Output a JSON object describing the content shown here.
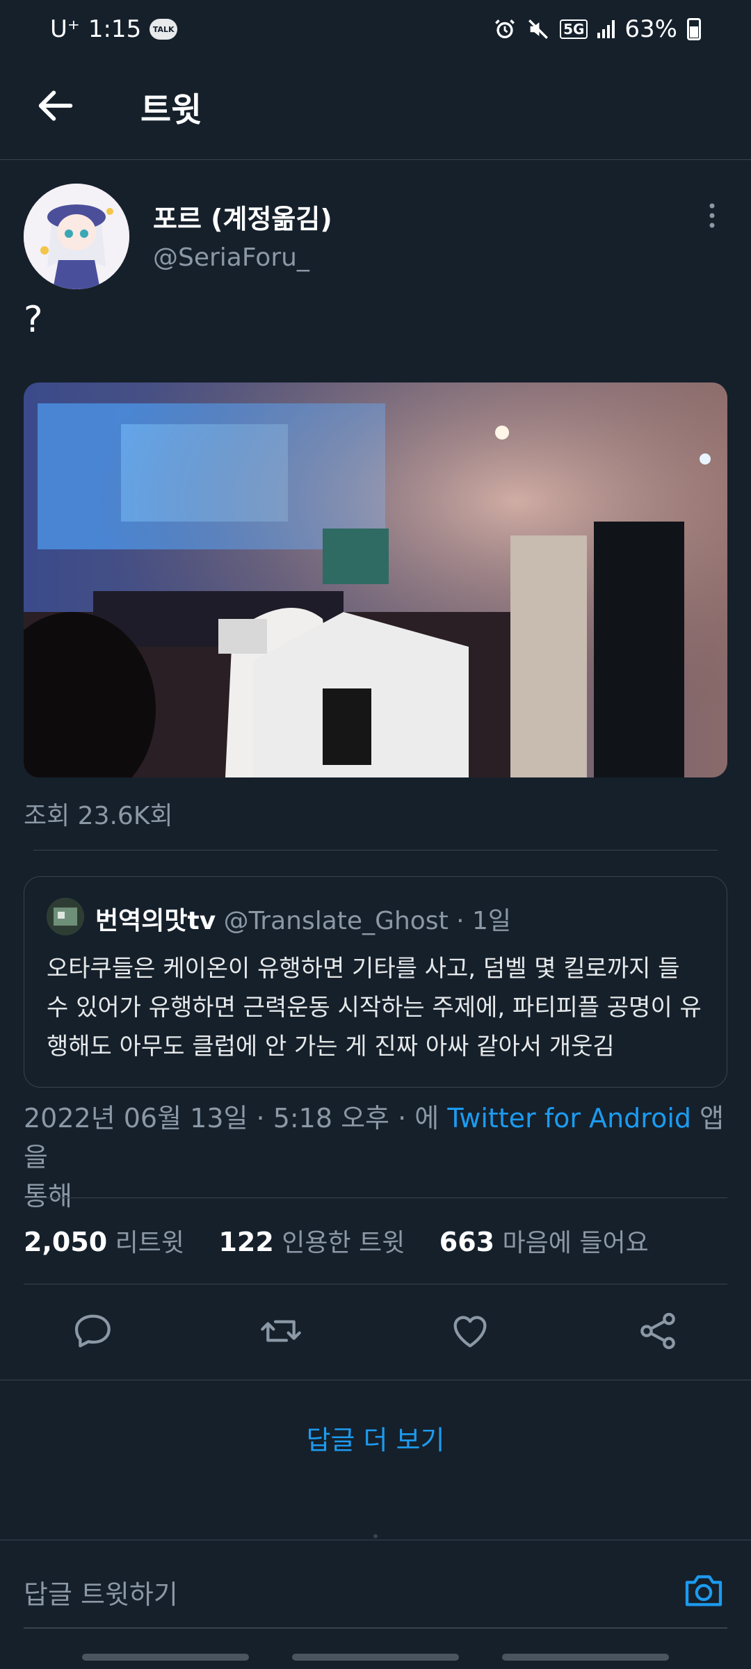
{
  "status_bar": {
    "carrier": "U⁺",
    "time": "1:15",
    "talk_badge": "TALK",
    "network": "5G",
    "battery": "63%"
  },
  "header": {
    "title": "트윗"
  },
  "tweet": {
    "display_name": "포르 (계정옮김)",
    "handle": "@SeriaForu_",
    "text": "?",
    "views_label": "조회 23.6K회",
    "date": "2022년 06월 13일 · 5:18 오후 · 에",
    "client": "Twitter for Android",
    "client_suffix": "앱을",
    "client_suffix2": "통해"
  },
  "quote": {
    "name": "번역의맛tv",
    "handle": "@Translate_Ghost",
    "age": "· 1일",
    "text": "오타쿠들은 케이온이 유행하면 기타를 사고, 덤벨 몇 킬로까지 들 수 있어가 유행하면 근력운동 시작하는 주제에, 파티피플 공명이 유행해도 아무도 클럽에 안 가는 게 진짜 아싸 같아서 개웃김"
  },
  "stats": {
    "retweets": "2,050",
    "retweets_label": "리트윗",
    "quotes": "122",
    "quotes_label": "인용한 트윗",
    "likes": "663",
    "likes_label": "마음에 들어요"
  },
  "actions": {
    "reply_icon": "reply-icon",
    "retweet_icon": "retweet-icon",
    "like_icon": "heart-icon",
    "share_icon": "share-icon"
  },
  "more_replies": "답글 더 보기",
  "reply_bar": {
    "placeholder": "답글 트윗하기"
  },
  "colors": {
    "background": "#15202b",
    "accent": "#1d9bf0",
    "muted": "#8b98a5",
    "border": "#38444d"
  }
}
